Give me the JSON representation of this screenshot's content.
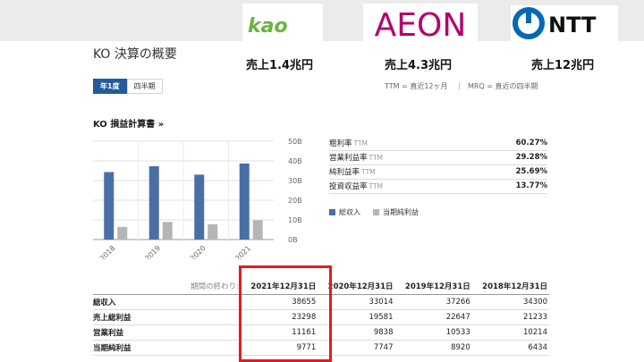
{
  "logos": {
    "kao": {
      "name": "kao",
      "color": "#6cb33f"
    },
    "aeon": {
      "name": "AEON",
      "color": "#b4006d"
    },
    "ntt": {
      "name": "NTT",
      "color": "#0068b7"
    }
  },
  "sales": {
    "kao": "売上1.4兆円",
    "aeon": "売上4.3兆円",
    "ntt": "売上12兆円"
  },
  "page": {
    "title": "KO 決算の概要"
  },
  "tabs": [
    {
      "label": "年1度",
      "active": true
    },
    {
      "label": "四半期",
      "active": false
    }
  ],
  "legend_top": {
    "ttm": "TTM = 直近12ヶ月",
    "sep": "|",
    "mrq": "MRQ = 直近の四半期"
  },
  "income_statement": {
    "title": "KO 損益計算書 »"
  },
  "chart_data": {
    "type": "bar",
    "categories": [
      "2018",
      "2019",
      "2020",
      "2021"
    ],
    "series": [
      {
        "name": "総収入",
        "values": [
          34.3,
          37.27,
          33.01,
          38.66
        ],
        "color": "#4a6fa5"
      },
      {
        "name": "当期純利益",
        "values": [
          6.43,
          8.92,
          7.75,
          9.77
        ],
        "color": "#b5b5b5"
      }
    ],
    "ylim": [
      0,
      50
    ],
    "yticks": [
      "0B",
      "10B",
      "20B",
      "30B",
      "40B",
      "50B"
    ],
    "grid": true,
    "legend": "bottom-right"
  },
  "ratios": [
    {
      "label": "粗利率",
      "tag": "TTM",
      "value": "60.27%"
    },
    {
      "label": "営業利益率",
      "tag": "TTM",
      "value": "29.28%"
    },
    {
      "label": "純利益率",
      "tag": "TTM",
      "value": "25.69%"
    },
    {
      "label": "投資収益率",
      "tag": "TTM",
      "value": "13.77%"
    }
  ],
  "table": {
    "header_label": "期間の終わり:",
    "columns": [
      "2021年12月31日",
      "2020年12月31日",
      "2019年12月31日",
      "2018年12月31日"
    ],
    "rows": [
      {
        "label": "総収入",
        "values": [
          "38655",
          "33014",
          "37266",
          "34300"
        ]
      },
      {
        "label": "売上総利益",
        "values": [
          "23298",
          "19581",
          "22647",
          "21233"
        ]
      },
      {
        "label": "営業利益",
        "values": [
          "11161",
          "9838",
          "10533",
          "10214"
        ]
      },
      {
        "label": "当期純利益",
        "values": [
          "9771",
          "7747",
          "8920",
          "6434"
        ]
      }
    ]
  }
}
